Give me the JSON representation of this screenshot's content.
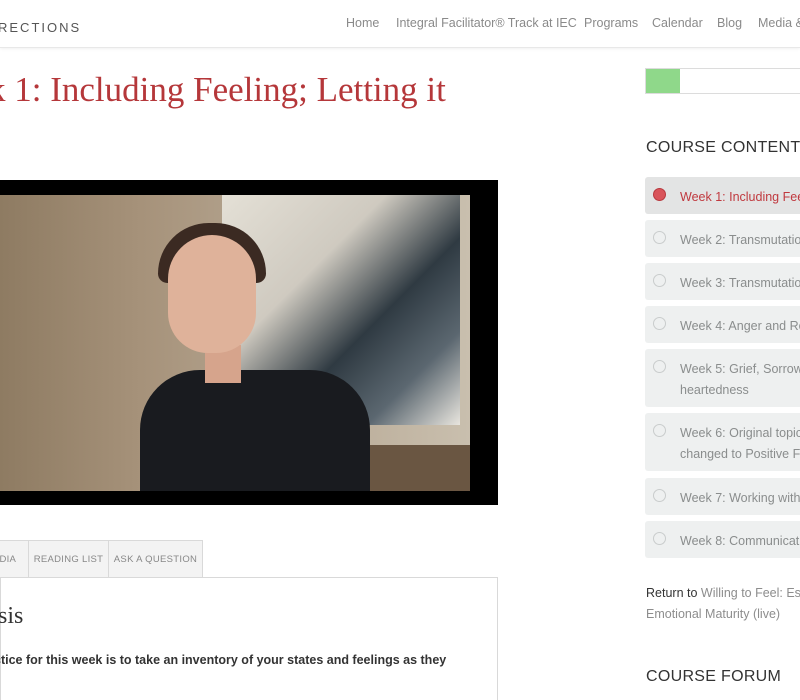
{
  "header": {
    "logo_text": "RECTIONS",
    "nav": [
      "Home",
      "Integral Facilitator® Track at IEC",
      "Programs",
      "Calendar",
      "Blog",
      "Media &"
    ]
  },
  "lesson": {
    "title": "k 1: Including Feeling; Letting it"
  },
  "tabs": [
    "EDIA",
    "READING LIST",
    "ASK A QUESTION"
  ],
  "panel": {
    "heading": "osis",
    "text": "ctice for this week is to take an inventory of your states and feelings as they"
  },
  "sidebar": {
    "progress_fraction": 0.2,
    "progress_color": "#8fd88a",
    "course_content_heading": "COURSE CONTENT",
    "lessons": [
      {
        "line1": "Week 1: Including Fee",
        "line2": "",
        "active": true
      },
      {
        "line1": "Week 2: Transmutatio",
        "line2": "",
        "active": false
      },
      {
        "line1": "Week 3: Transmutatio",
        "line2": "",
        "active": false
      },
      {
        "line1": "Week 4: Anger and Re",
        "line2": "",
        "active": false
      },
      {
        "line1": "Week 5: Grief, Sorrow",
        "line2": "heartedness",
        "active": false
      },
      {
        "line1": "Week 6: Original topic",
        "line2": "changed to Positive F",
        "active": false
      },
      {
        "line1": "Week 7: Working with",
        "line2": "",
        "active": false
      },
      {
        "line1": "Week 8: Communicati",
        "line2": "",
        "active": false
      }
    ],
    "return_prefix": "Return to",
    "return_link_line1": "Willing to Feel: Es",
    "return_link_line2": "Emotional Maturity (live)",
    "forum_heading": "COURSE FORUM"
  },
  "colors": {
    "title": "#b5373a",
    "active_lesson": "#c0393f"
  }
}
